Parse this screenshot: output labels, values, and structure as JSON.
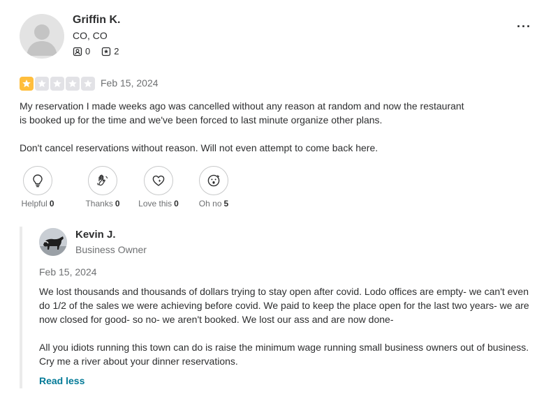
{
  "review": {
    "user": {
      "name": "Griffin K.",
      "location": "CO, CO",
      "friends_count": "0",
      "reviews_count": "2"
    },
    "rating": 1,
    "rating_max": 5,
    "date": "Feb 15, 2024",
    "paragraphs": [
      "My reservation I made weeks ago was cancelled without any reason at random and now the restaurant is booked up for the time and we've been forced to last minute organize other plans.",
      "Don't cancel reservations without reason. Will not even attempt to come back here."
    ],
    "reactions": [
      {
        "label": "Helpful",
        "count": "0",
        "icon": "lightbulb-icon"
      },
      {
        "label": "Thanks",
        "count": "0",
        "icon": "waving-hand-icon"
      },
      {
        "label": "Love this",
        "count": "0",
        "icon": "heart-sparkle-icon"
      },
      {
        "label": "Oh no",
        "count": "5",
        "icon": "surprised-face-icon"
      }
    ]
  },
  "owner_reply": {
    "name": "Kevin J.",
    "role": "Business Owner",
    "date": "Feb 15, 2024",
    "paragraphs": [
      "We lost thousands and thousands of dollars trying to stay open after covid. Lodo offices are empty- we can't even do 1/2 of the sales we were achieving before covid. We paid to keep the place open for the last two years- we are now closed for good- so no- we aren't booked. We lost our ass and are now done-",
      "All you idiots running this town can do is raise the minimum wage running small business owners out of business. Cry me a river about your dinner reservations."
    ],
    "toggle_label": "Read less"
  },
  "colors": {
    "star_on": "#ffbe3d",
    "star_off": "#e2e2e6",
    "link": "#027a97",
    "reply_border": "#ebebeb"
  }
}
